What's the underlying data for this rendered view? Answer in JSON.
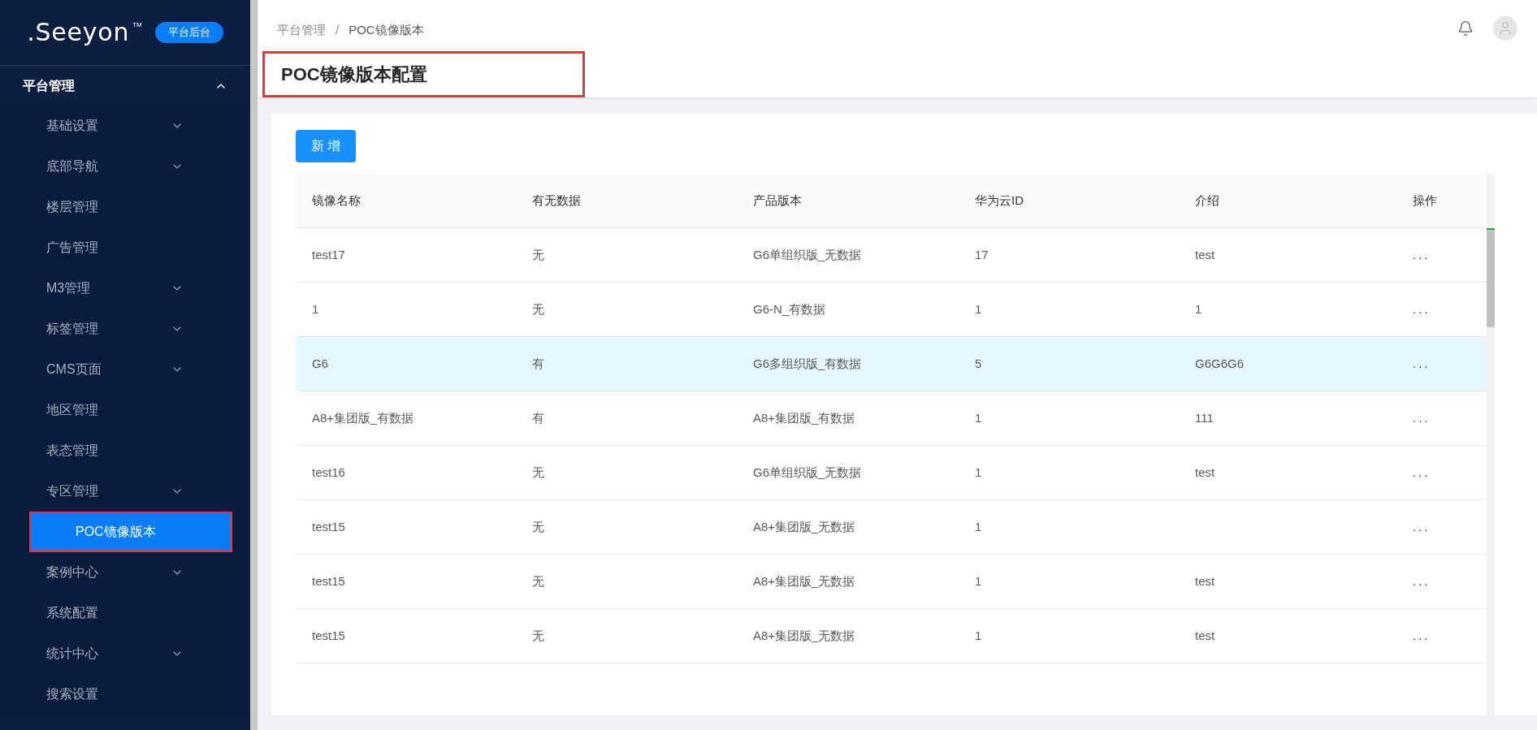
{
  "brand": {
    "logo": ".Seeyon",
    "trademark": "TM",
    "badge": "平台后台"
  },
  "sidebar": {
    "group": {
      "label": "平台管理",
      "expanded": true
    },
    "items": [
      {
        "label": "基础设置",
        "kind": "submenu",
        "selected": false,
        "highlighted": false
      },
      {
        "label": "底部导航",
        "kind": "submenu",
        "selected": false,
        "highlighted": false
      },
      {
        "label": "楼层管理",
        "kind": "item",
        "selected": false,
        "highlighted": false
      },
      {
        "label": "广告管理",
        "kind": "item",
        "selected": false,
        "highlighted": false
      },
      {
        "label": "M3管理",
        "kind": "submenu",
        "selected": false,
        "highlighted": false
      },
      {
        "label": "标签管理",
        "kind": "submenu",
        "selected": false,
        "highlighted": false
      },
      {
        "label": "CMS页面",
        "kind": "submenu",
        "selected": false,
        "highlighted": false
      },
      {
        "label": "地区管理",
        "kind": "item",
        "selected": false,
        "highlighted": false
      },
      {
        "label": "表态管理",
        "kind": "item",
        "selected": false,
        "highlighted": false
      },
      {
        "label": "专区管理",
        "kind": "submenu",
        "selected": false,
        "highlighted": false
      },
      {
        "label": "POC镜像版本",
        "kind": "item",
        "selected": true,
        "highlighted": true
      },
      {
        "label": "案例中心",
        "kind": "submenu",
        "selected": false,
        "highlighted": false
      },
      {
        "label": "系统配置",
        "kind": "item",
        "selected": false,
        "highlighted": false
      },
      {
        "label": "统计中心",
        "kind": "submenu",
        "selected": false,
        "highlighted": false
      },
      {
        "label": "搜索设置",
        "kind": "item",
        "selected": false,
        "highlighted": false
      }
    ]
  },
  "breadcrumb": [
    "平台管理",
    "POC镜像版本"
  ],
  "breadcrumb_separator": "/",
  "page_title": {
    "text": "POC镜像版本配置",
    "highlighted": true
  },
  "add_button": "新 增",
  "table": {
    "columns": [
      "镜像名称",
      "有无数据",
      "产品版本",
      "华为云ID",
      "介绍",
      "操作"
    ],
    "rows": [
      {
        "cells": [
          "test17",
          "无",
          "G6单组织版_无数据",
          "17",
          "test",
          "..."
        ],
        "selected": false
      },
      {
        "cells": [
          "1",
          "无",
          "G6-N_有数据",
          "1",
          "1",
          "..."
        ],
        "selected": false
      },
      {
        "cells": [
          "G6",
          "有",
          "G6多组织版_有数据",
          "5",
          "G6G6G6",
          "..."
        ],
        "selected": true
      },
      {
        "cells": [
          "A8+集团版_有数据",
          "有",
          "A8+集团版_有数据",
          "1",
          "111",
          "..."
        ],
        "selected": false
      },
      {
        "cells": [
          "test16",
          "无",
          "G6单组织版_无数据",
          "1",
          "test",
          "..."
        ],
        "selected": false
      },
      {
        "cells": [
          "test15",
          "无",
          "A8+集团版_无数据",
          "1",
          "",
          "..."
        ],
        "selected": false
      },
      {
        "cells": [
          "test15",
          "无",
          "A8+集团版_无数据",
          "1",
          "test",
          "..."
        ],
        "selected": false
      },
      {
        "cells": [
          "test15",
          "无",
          "A8+集团版_无数据",
          "1",
          "test",
          "..."
        ],
        "selected": false
      }
    ]
  }
}
